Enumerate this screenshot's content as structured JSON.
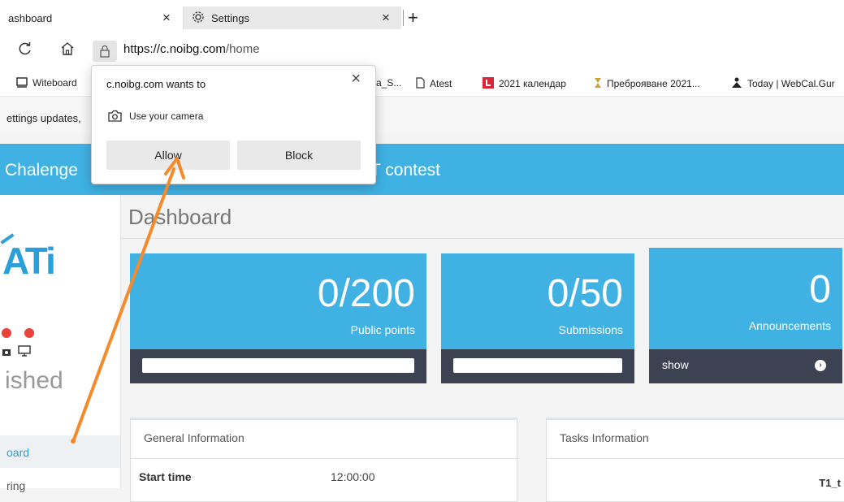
{
  "browser": {
    "tabs": [
      {
        "label": "ashboard",
        "close": "×"
      },
      {
        "label": "Settings",
        "close": "×"
      }
    ],
    "new_tab": "+",
    "url_host": "https://c.noibg.com",
    "url_path": "/home",
    "bookmarks": [
      {
        "label": "Witeboard",
        "icon": "whiteboard-icon"
      },
      {
        "label": "a_S...",
        "icon": "bookmark-icon"
      },
      {
        "label": "Atest",
        "icon": "page-icon"
      },
      {
        "label": "2021 календар",
        "icon": "calendar-app-icon"
      },
      {
        "label": "Преброяване 2021...",
        "icon": "census-icon"
      },
      {
        "label": "Today | WebCal.Gur",
        "icon": "webcal-icon"
      }
    ],
    "infobar_text": "ettings updates,"
  },
  "popup": {
    "title": "c.noibg.com wants to",
    "close": "×",
    "permission": "Use your camera",
    "allow": "Allow",
    "block": "Block"
  },
  "site": {
    "brand": "Chalenge",
    "contest": "T contest",
    "logo_text": "ATi",
    "published": "ished",
    "sidebar_items": [
      "oard",
      "ring"
    ]
  },
  "dashboard": {
    "title": "Dashboard",
    "cards": [
      {
        "value": "0/200",
        "label": "Public points",
        "progress": 0
      },
      {
        "value": "0/50",
        "label": "Submissions",
        "progress": 0
      },
      {
        "value": "0",
        "label": "Announcements",
        "show": "show"
      }
    ],
    "general_info": {
      "title": "General Information",
      "row_label": "Start time",
      "row_value": "12:00:00"
    },
    "tasks_info": {
      "title": "Tasks Information",
      "column": "T1_t"
    }
  },
  "colors": {
    "accent": "#3fb1e3",
    "card_footer": "#3d4252",
    "arrow": "#f58a2a",
    "status_dot": "#e8433a"
  }
}
